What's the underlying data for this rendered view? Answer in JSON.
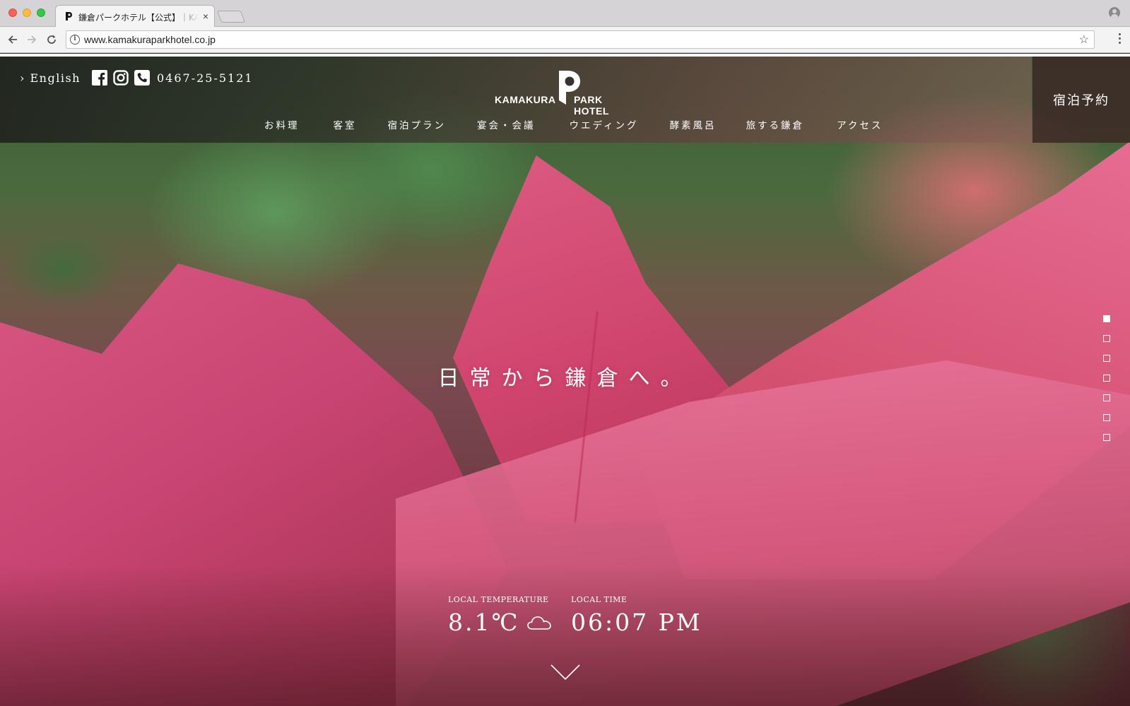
{
  "browser": {
    "tab_title": "鎌倉パークホテル【公式】｜KAMAKURA PARK HOTEL",
    "tab_close": "×",
    "url": "www.kamakuraparkhotel.co.jp",
    "info_glyph": "i",
    "star_glyph": "☆"
  },
  "header": {
    "english": "› English",
    "phone": "0467-25-5121",
    "logo_left": "KAMAKURA",
    "logo_right": "PARK HOTEL",
    "reserve": "宿泊予約",
    "nav": [
      "お料理",
      "客室",
      "宿泊プラン",
      "宴会・会議",
      "ウエディング",
      "酵素風呂",
      "旅する鎌倉",
      "アクセス"
    ]
  },
  "hero": {
    "tagline": "日常から鎌倉へ。",
    "slide_count": 7,
    "active_slide": 1
  },
  "info": {
    "temp_label": "LOCAL TEMPERATURE",
    "temp_value": "8.1℃",
    "weather_icon": "cloud-icon",
    "time_label": "LOCAL TIME",
    "time_value": "06:07 PM"
  },
  "colors": {
    "leaf_pink": "#d4446f",
    "reserve_bg": "#3c2826"
  }
}
